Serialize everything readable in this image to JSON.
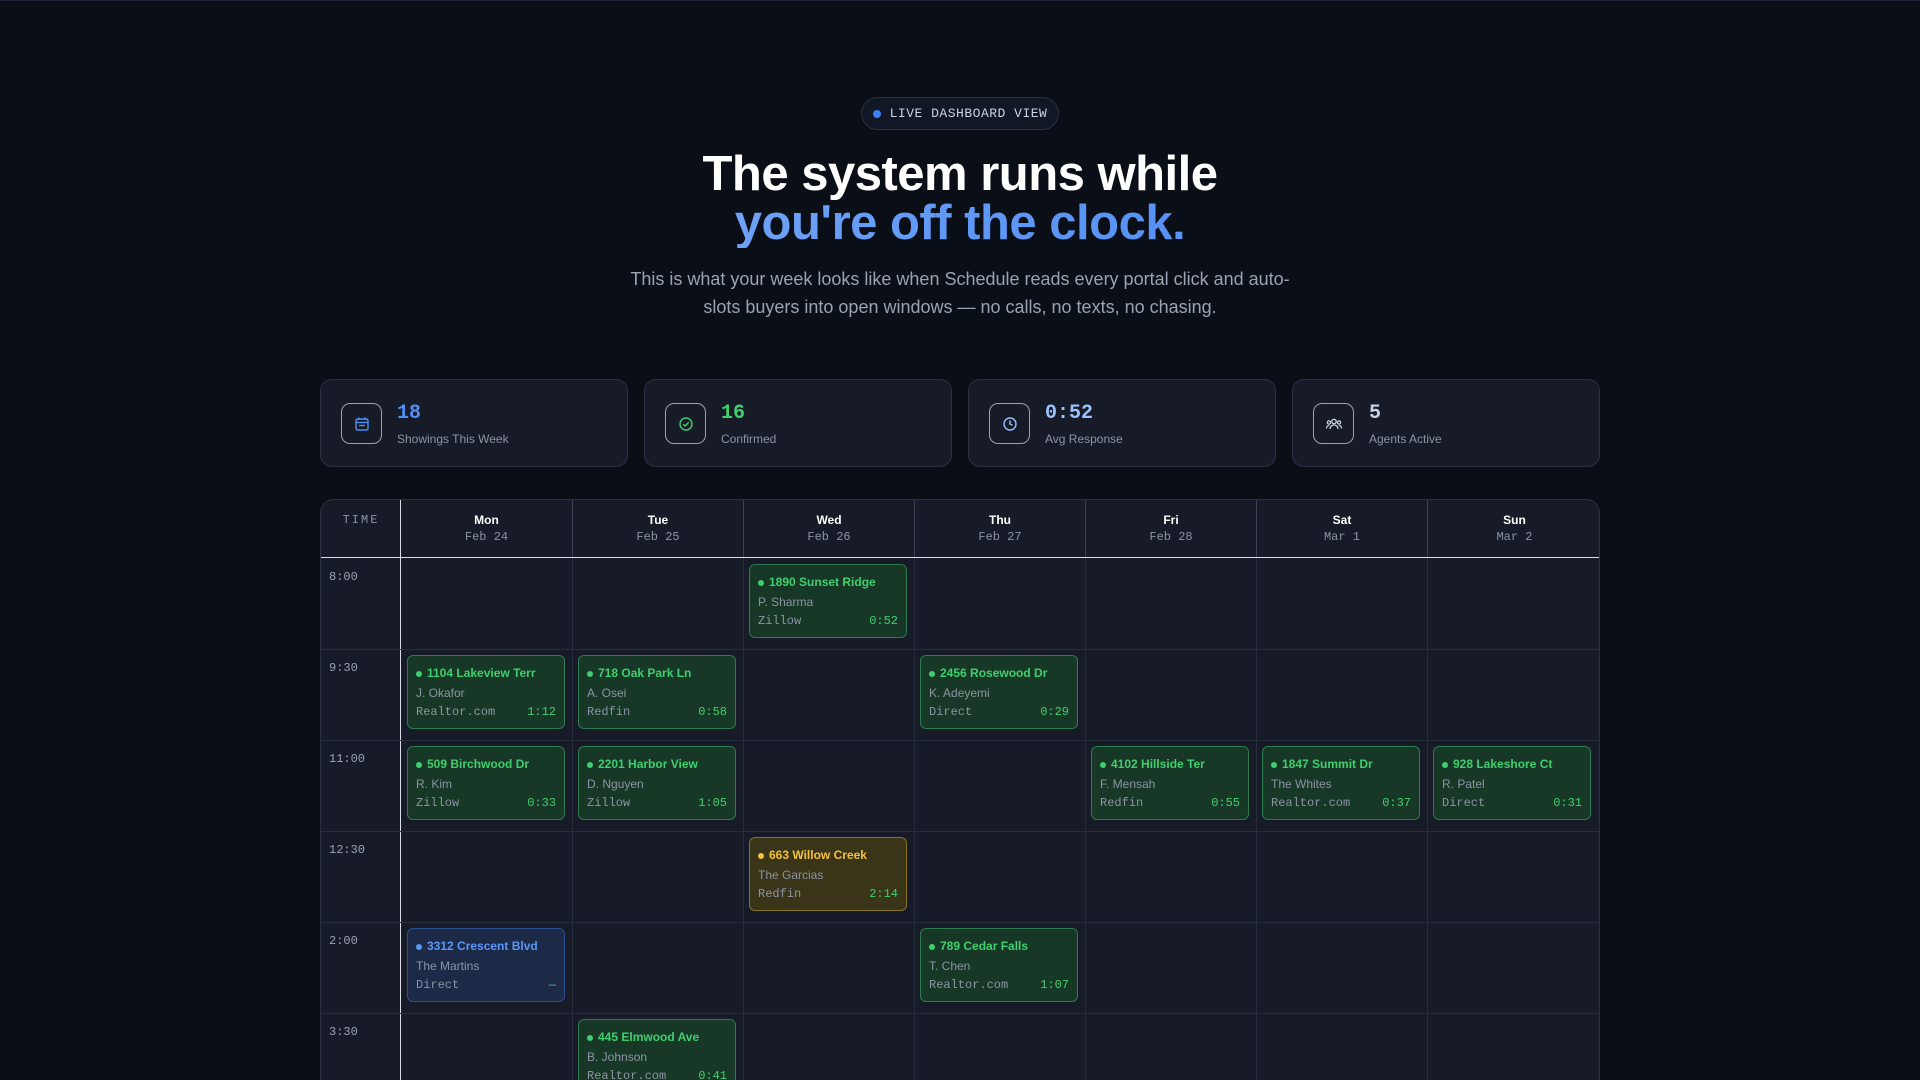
{
  "badge": {
    "label": "LIVE DASHBOARD VIEW",
    "dot_color": "#3b82f6"
  },
  "headline": {
    "line1": "The system runs while",
    "line2": "you're off the clock."
  },
  "subtitle": "This is what your week looks like when Schedule reads every portal click and auto-slots buyers into open windows — no calls, no texts, no chasing.",
  "stats": [
    {
      "icon": "calendar-icon",
      "value": "18",
      "label": "Showings This Week",
      "color": "#4f8ff7"
    },
    {
      "icon": "check-circle-icon",
      "value": "16",
      "label": "Confirmed",
      "color": "#3fcf6e"
    },
    {
      "icon": "clock-icon",
      "value": "0:52",
      "label": "Avg Response",
      "color": "#9cc2ff"
    },
    {
      "icon": "users-icon",
      "value": "5",
      "label": "Agents Active",
      "color": "#c9d2e3"
    }
  ],
  "calendar": {
    "time_header": "TIME",
    "days": [
      {
        "name": "Mon",
        "date": "Feb 24"
      },
      {
        "name": "Tue",
        "date": "Feb 25"
      },
      {
        "name": "Wed",
        "date": "Feb 26"
      },
      {
        "name": "Thu",
        "date": "Feb 27"
      },
      {
        "name": "Fri",
        "date": "Feb 28"
      },
      {
        "name": "Sat",
        "date": "Mar 1"
      },
      {
        "name": "Sun",
        "date": "Mar 2"
      }
    ],
    "times": [
      "8:00",
      "9:30",
      "11:00",
      "12:30",
      "2:00",
      "3:30"
    ],
    "events": [
      {
        "day": 2,
        "slot": 0,
        "address": "1890 Sunset Ridge",
        "buyer": "P. Sharma",
        "source": "Zillow",
        "response": "0:52",
        "status": "confirmed"
      },
      {
        "day": 0,
        "slot": 1,
        "address": "1104 Lakeview Terr",
        "buyer": "J. Okafor",
        "source": "Realtor.com",
        "response": "1:12",
        "status": "confirmed"
      },
      {
        "day": 1,
        "slot": 1,
        "address": "718 Oak Park Ln",
        "buyer": "A. Osei",
        "source": "Redfin",
        "response": "0:58",
        "status": "confirmed"
      },
      {
        "day": 3,
        "slot": 1,
        "address": "2456 Rosewood Dr",
        "buyer": "K. Adeyemi",
        "source": "Direct",
        "response": "0:29",
        "status": "confirmed"
      },
      {
        "day": 0,
        "slot": 2,
        "address": "509 Birchwood Dr",
        "buyer": "R. Kim",
        "source": "Zillow",
        "response": "0:33",
        "status": "confirmed"
      },
      {
        "day": 1,
        "slot": 2,
        "address": "2201 Harbor View",
        "buyer": "D. Nguyen",
        "source": "Zillow",
        "response": "1:05",
        "status": "confirmed"
      },
      {
        "day": 4,
        "slot": 2,
        "address": "4102 Hillside Ter",
        "buyer": "F. Mensah",
        "source": "Redfin",
        "response": "0:55",
        "status": "confirmed"
      },
      {
        "day": 5,
        "slot": 2,
        "address": "1847 Summit Dr",
        "buyer": "The Whites",
        "source": "Realtor.com",
        "response": "0:37",
        "status": "confirmed"
      },
      {
        "day": 6,
        "slot": 2,
        "address": "928 Lakeshore Ct",
        "buyer": "R. Patel",
        "source": "Direct",
        "response": "0:31",
        "status": "confirmed"
      },
      {
        "day": 2,
        "slot": 3,
        "address": "663 Willow Creek",
        "buyer": "The Garcias",
        "source": "Redfin",
        "response": "2:14",
        "status": "pending"
      },
      {
        "day": 0,
        "slot": 4,
        "address": "3312 Crescent Blvd",
        "buyer": "The Martins",
        "source": "Direct",
        "response": "—",
        "status": "blue"
      },
      {
        "day": 3,
        "slot": 4,
        "address": "789 Cedar Falls",
        "buyer": "T. Chen",
        "source": "Realtor.com",
        "response": "1:07",
        "status": "confirmed"
      },
      {
        "day": 1,
        "slot": 5,
        "address": "445 Elmwood Ave",
        "buyer": "B. Johnson",
        "source": "Realtor.com",
        "response": "0:41",
        "status": "confirmed"
      }
    ]
  }
}
